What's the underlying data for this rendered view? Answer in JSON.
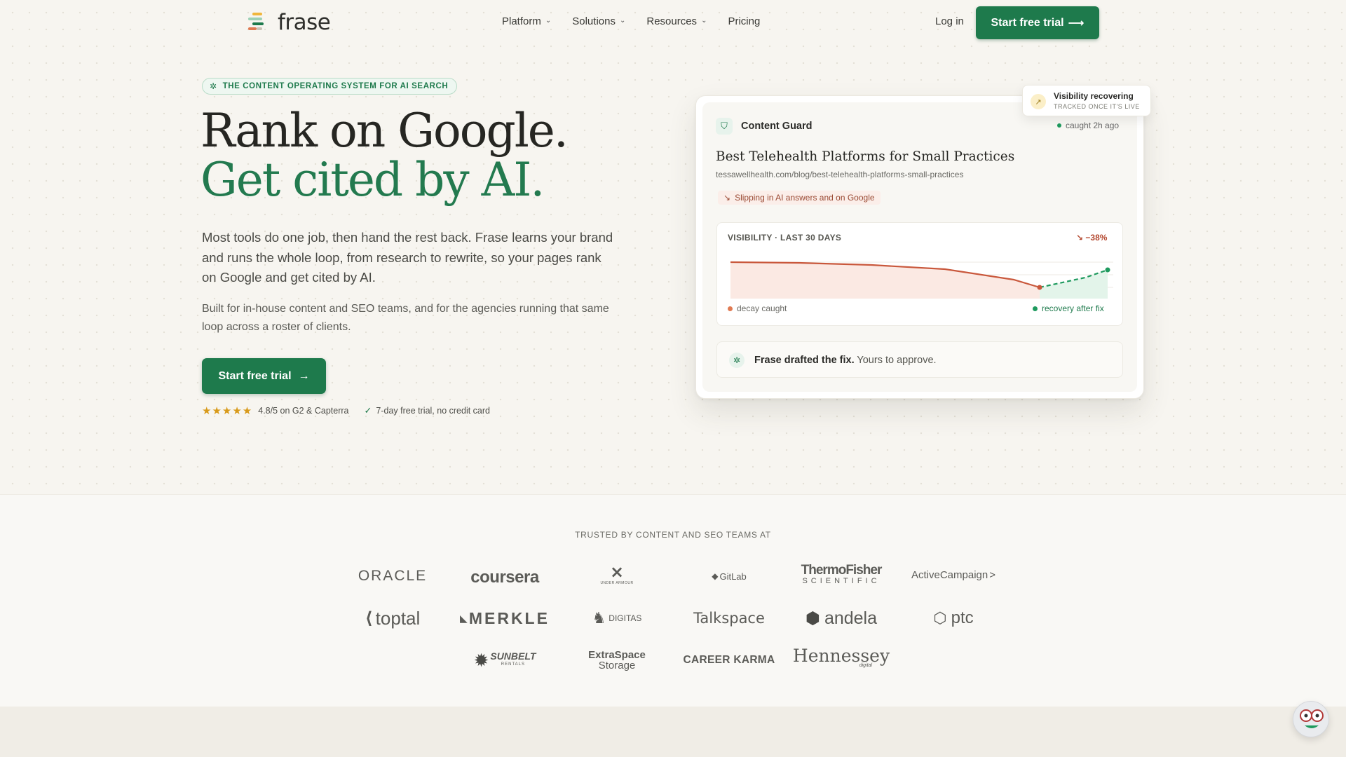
{
  "nav": {
    "logo_text": "frase",
    "links": [
      {
        "label": "Platform",
        "has_menu": true
      },
      {
        "label": "Solutions",
        "has_menu": true
      },
      {
        "label": "Resources",
        "has_menu": true
      },
      {
        "label": "Pricing",
        "has_menu": false
      }
    ],
    "login": "Log in",
    "cta": "Start free trial",
    "cta_arrow": "⟶"
  },
  "hero": {
    "eyebrow": "THE CONTENT OPERATING SYSTEM FOR AI SEARCH",
    "title_line1": "Rank on Google.",
    "title_line2": "Get cited by AI.",
    "lead": "Most tools do one job, then hand the rest back. Frase learns your brand and runs the whole loop, from research to rewrite, so your pages rank on Google and get cited by AI.",
    "sub": "Built for in-house content and SEO teams, and for the agencies running that same loop across a roster of clients.",
    "cta": "Start free trial",
    "cta_arrow": "→",
    "stars": "★★★★★",
    "rating": "4.8/5 on G2 & Capterra",
    "trial_note": "7-day free trial, no credit card"
  },
  "card": {
    "title": "Content Guard",
    "caught": "caught 2h ago",
    "article_title": "Best Telehealth Platforms for Small Practices",
    "article_url": "tessawellhealth.com/blog/best-telehealth-platforms-small-practices",
    "alert": "Slipping in AI answers and on Google",
    "chart_label": "VISIBILITY · LAST 30 DAYS",
    "chart_delta": "−38%",
    "legend_decay": "decay caught",
    "legend_recovery": "recovery after fix",
    "fix_bold": "Frase drafted the fix.",
    "fix_rest": "Yours to approve.",
    "toast_title": "Visibility recovering",
    "toast_sub": "TRACKED ONCE IT'S LIVE",
    "colors": {
      "decay": "#c9583c",
      "recovery": "#1e9a5e"
    }
  },
  "trusted": {
    "label": "TRUSTED BY CONTENT AND SEO TEAMS AT",
    "logos": [
      [
        "ORACLE",
        "coursera",
        "UNDER ARMOUR",
        "GitLab",
        "ThermoFisher",
        "ActiveCampaign"
      ],
      [
        "toptal",
        "MERKLE",
        "DIGITAS",
        "Talkspace",
        "andela",
        "ptc"
      ],
      [
        "SUNBELT",
        "ExtraSpace",
        "CAREER KARMA",
        "Hennessey"
      ]
    ],
    "logo_sub": {
      "thermo": "SCIENTIFIC",
      "sunbelt": "RENTALS",
      "extraspace": "Storage",
      "hennessey": "digital"
    }
  }
}
